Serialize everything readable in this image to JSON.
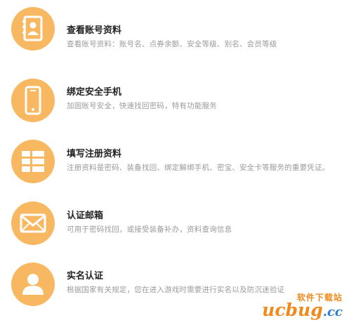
{
  "colors": {
    "icon_circle": "#f8b862",
    "icon_glyph": "#ffffff",
    "title": "#222222",
    "description": "#9a9a9a",
    "watermark_orange": "#f08a1c",
    "watermark_blue": "#2f7fd0"
  },
  "items": [
    {
      "icon": "contact-book-icon",
      "title": "查看账号资料",
      "description": "查看账号资料：账号名、点券余额、安全等级、别名、会员等级"
    },
    {
      "icon": "mobile-phone-icon",
      "title": "绑定安全手机",
      "description": "加固账号安全，快速找回密码，特有功能服务"
    },
    {
      "icon": "form-list-icon",
      "title": "填写注册资料",
      "description": "注册资料是密码、装备找回、绑定解绑手机、密宝、安全卡等服务的重要凭证。"
    },
    {
      "icon": "envelope-icon",
      "title": "认证邮箱",
      "description": "可用于密码找回，或接受装备补办，资料查询信息"
    },
    {
      "icon": "person-silhouette-icon",
      "title": "实名认证",
      "description": "根据国家有关规定，您在进入游戏时需要进行实名以及防沉迷验证"
    }
  ],
  "watermark": {
    "top_text": "软件下载站",
    "main_text": "ucbug",
    "suffix": ".cc"
  }
}
